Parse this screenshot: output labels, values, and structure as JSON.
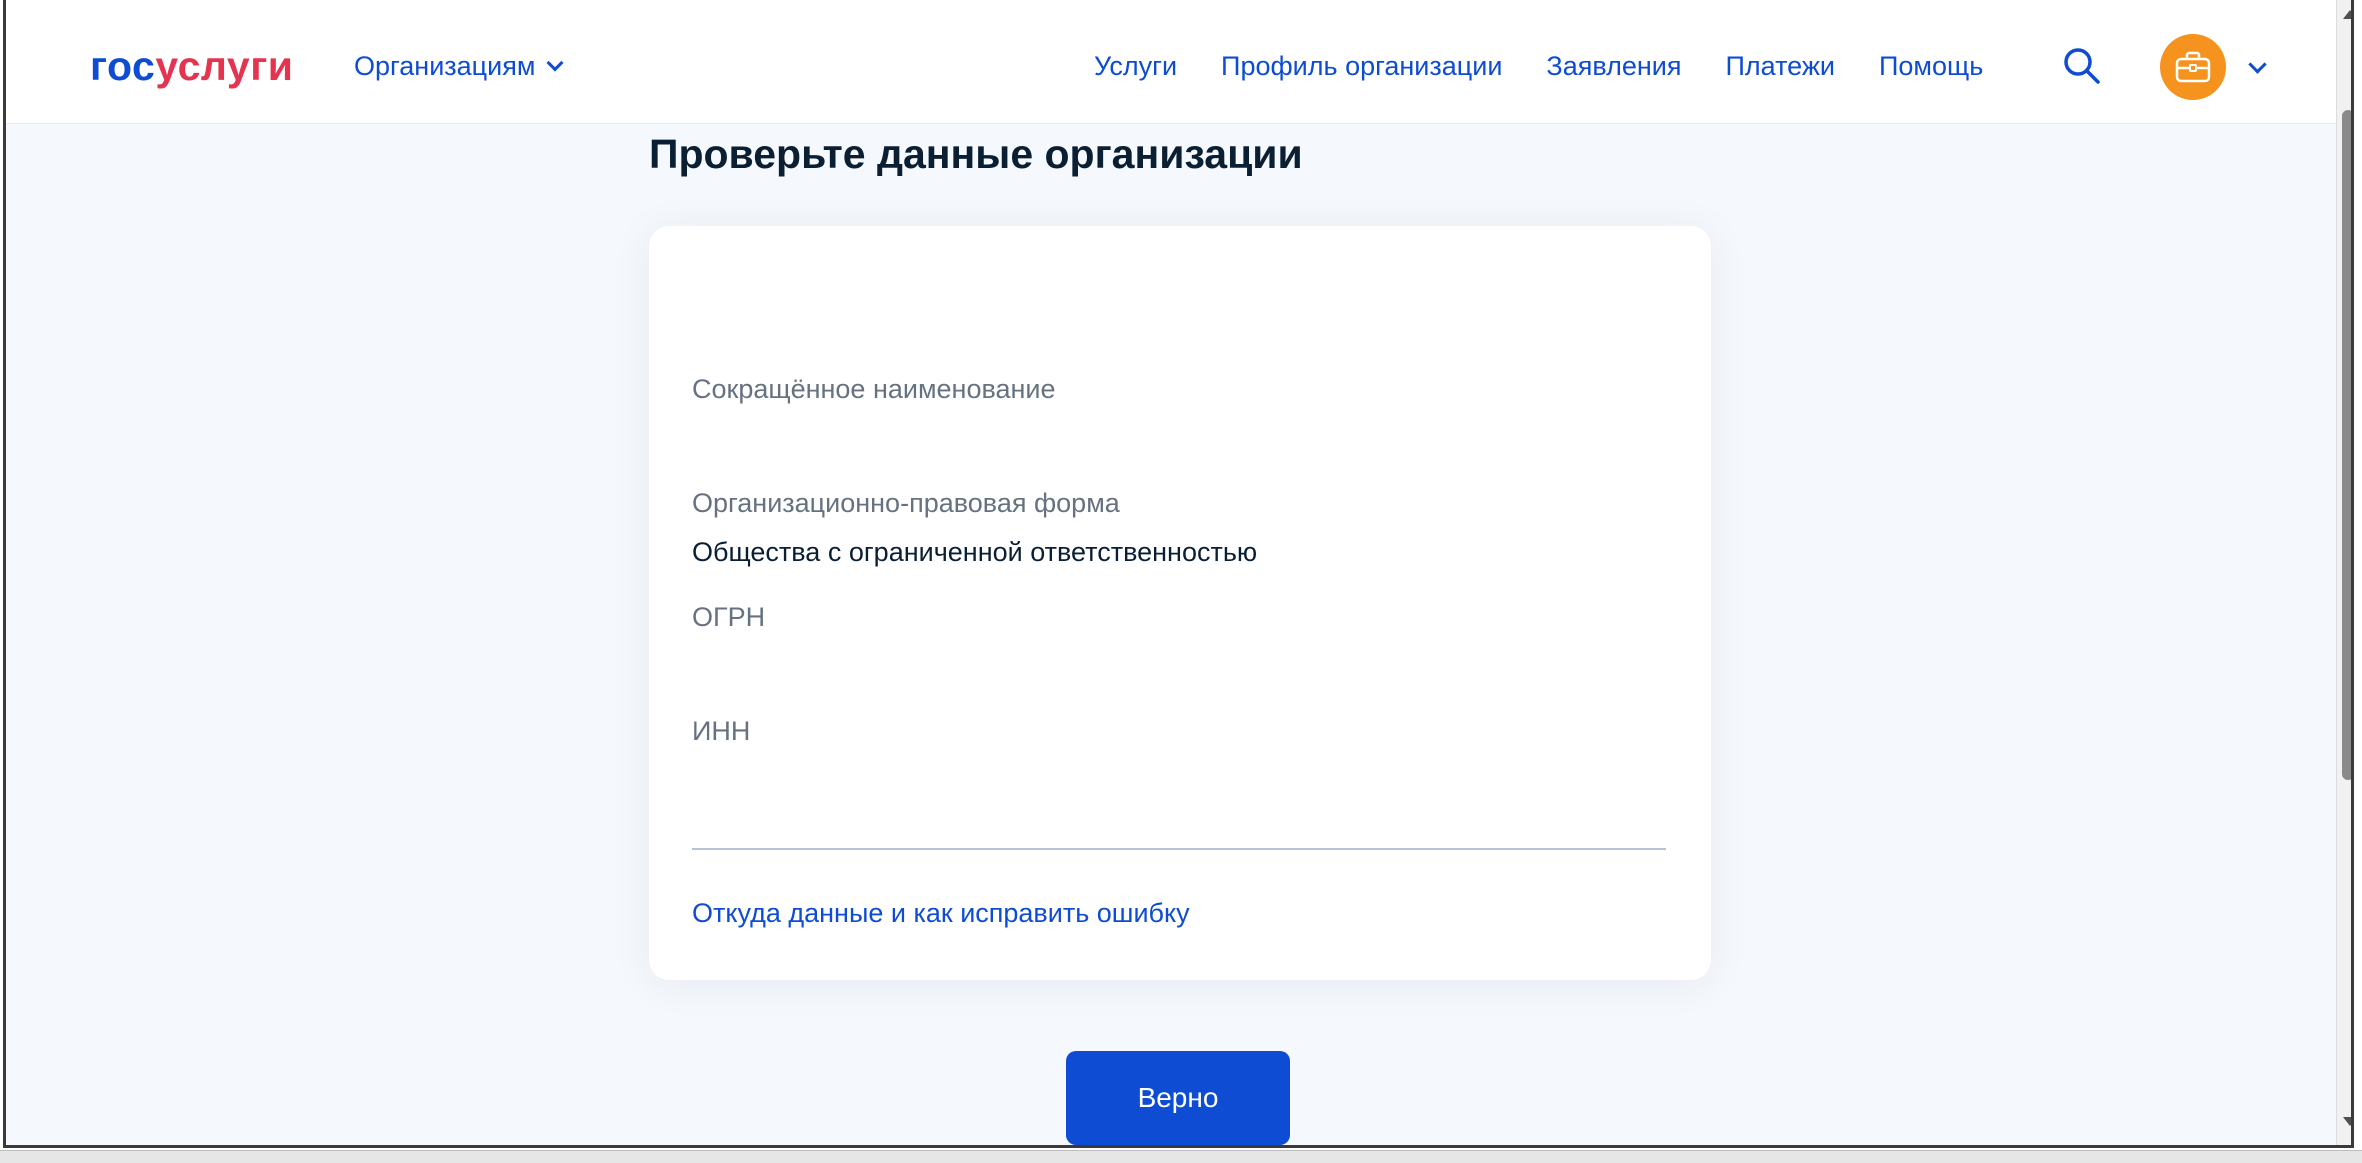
{
  "header": {
    "logo": {
      "part1": "гос",
      "part2": "услуги"
    },
    "org_menu_label": "Организациям",
    "nav": [
      "Услуги",
      "Профиль организации",
      "Заявления",
      "Платежи",
      "Помощь"
    ]
  },
  "page": {
    "title": "Проверьте данные организации"
  },
  "card": {
    "short_name_label": "Сокращённое наименование",
    "short_name_value": "",
    "legal_form_label": "Организационно-правовая форма",
    "legal_form_value": "Общества с ограниченной ответственностью",
    "ogrn_label": "ОГРН",
    "ogrn_value": "",
    "inn_label": "ИНН",
    "inn_value": "",
    "help_link": "Откуда данные и как исправить ошибку"
  },
  "actions": {
    "confirm_label": "Верно"
  },
  "colors": {
    "brand_blue": "#0d4cd3",
    "brand_red": "#e4344f",
    "avatar_orange": "#f6921e",
    "text_dark": "#0b1f33",
    "text_muted": "#66727f",
    "page_bg": "#f5f8fc"
  },
  "icons": [
    "search-icon",
    "briefcase-icon",
    "chevron-down-icon"
  ]
}
